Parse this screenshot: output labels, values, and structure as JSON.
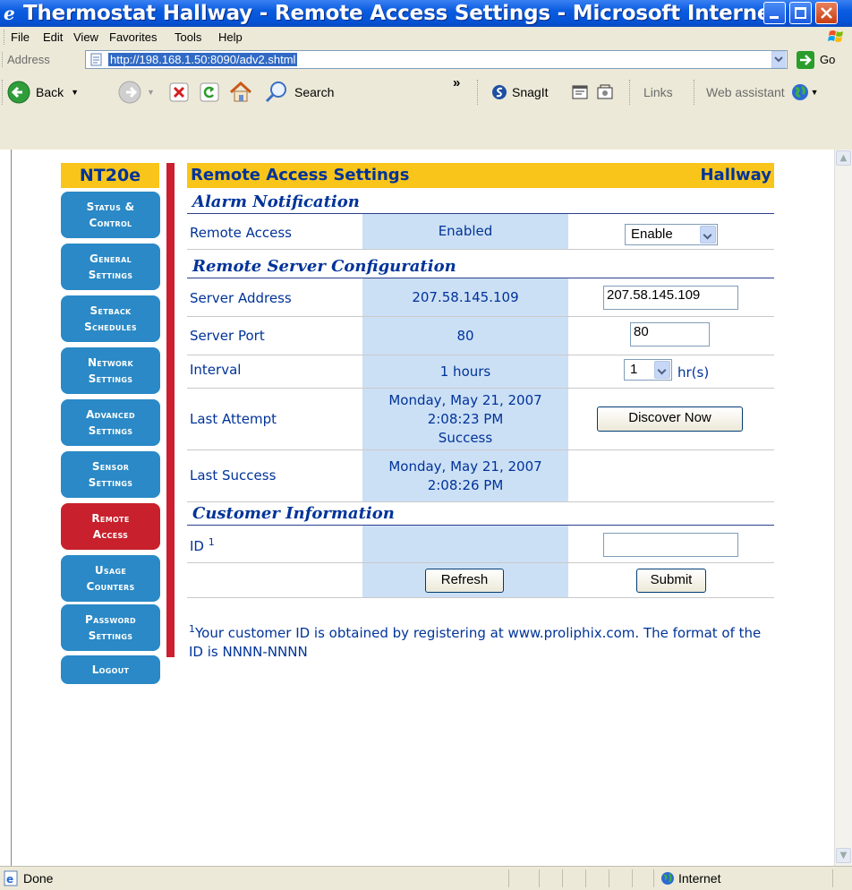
{
  "window": {
    "title": "Thermostat Hallway - Remote Access Settings - Microsoft Internet ...",
    "icon": "ie-icon"
  },
  "menu": [
    "File",
    "Edit",
    "View",
    "Favorites",
    "Tools",
    "Help"
  ],
  "address": {
    "label": "Address",
    "url": "http://198.168.1.50:8090/adv2.shtml",
    "go_label": "Go"
  },
  "toolbar": {
    "back_label": "Back",
    "search_label": "Search",
    "chevron": "»",
    "snagit_label": "SnagIt",
    "links_label": "Links",
    "web_assistant_label": "Web assistant"
  },
  "nav": {
    "logo": "NT20e",
    "items": [
      {
        "line1": "Status &",
        "line2": "Control"
      },
      {
        "line1": "General",
        "line2": "Settings"
      },
      {
        "line1": "Setback",
        "line2": "Schedules"
      },
      {
        "line1": "Network",
        "line2": "Settings"
      },
      {
        "line1": "Advanced",
        "line2": "Settings"
      },
      {
        "line1": "Sensor",
        "line2": "Settings"
      },
      {
        "line1": "Remote",
        "line2": "Access"
      },
      {
        "line1": "Usage",
        "line2": "Counters"
      },
      {
        "line1": "Password",
        "line2": "Settings"
      },
      {
        "line1": "Logout",
        "line2": ""
      }
    ],
    "active_index": 6
  },
  "page": {
    "title": "Remote Access Settings",
    "location": "Hallway"
  },
  "alarm": {
    "section": "Alarm Notification",
    "remote_access_label": "Remote Access",
    "remote_access_value": "Enabled",
    "remote_access_select": "Enable"
  },
  "server": {
    "section": "Remote Server Configuration",
    "address_label": "Server Address",
    "address_value": "207.58.145.109",
    "address_input": "207.58.145.109",
    "port_label": "Server Port",
    "port_value": "80",
    "port_input": "80",
    "interval_label": "Interval",
    "interval_value": "1 hours",
    "interval_select": "1",
    "interval_unit": "hr(s)",
    "last_attempt_label": "Last Attempt",
    "last_attempt_date": "Monday, May 21, 2007",
    "last_attempt_time": "2:08:23 PM",
    "last_attempt_status": "Success",
    "discover_button": "Discover Now",
    "last_success_label": "Last Success",
    "last_success_date": "Monday, May 21, 2007",
    "last_success_time": "2:08:26 PM"
  },
  "customer": {
    "section": "Customer Information",
    "id_label": "ID",
    "id_sup": "1",
    "id_input": "",
    "refresh_button": "Refresh",
    "submit_button": "Submit"
  },
  "footnote": {
    "sup": "1",
    "text": "Your customer ID is obtained by registering at www.proliphix.com. The format of the ID is NNNN-NNNN"
  },
  "status": {
    "text": "Done",
    "zone": "Internet"
  },
  "colors": {
    "titlebar": "#0a5ce0",
    "nav_blue": "#2a89c6",
    "nav_active": "#c8202c",
    "header_gold": "#f9c51a",
    "text_blue": "#003399",
    "cell_blue": "#cce0f5"
  }
}
